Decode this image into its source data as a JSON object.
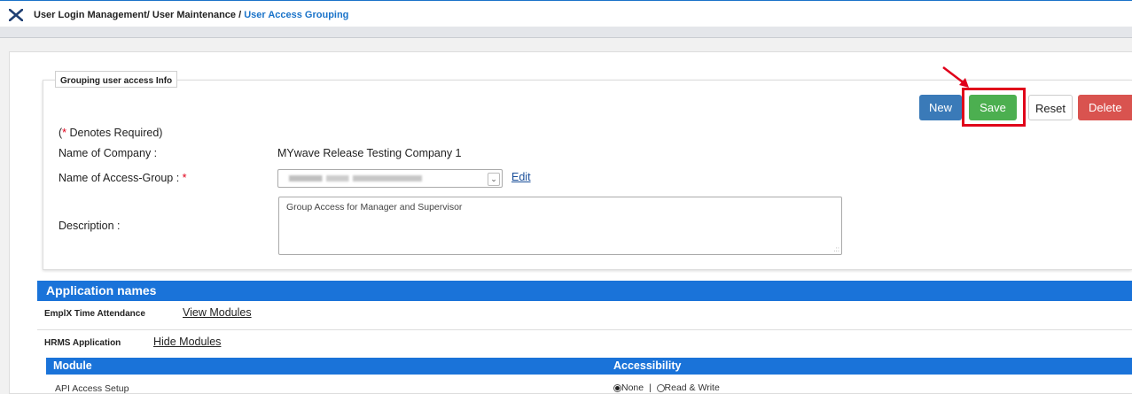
{
  "breadcrumb": {
    "part1": "User Login Management",
    "sep1": "/",
    "part2": "User Maintenance",
    "sep2": "/",
    "current": "User Access Grouping"
  },
  "panel": {
    "legend": "Grouping user access Info"
  },
  "toolbar": {
    "new_label": "New",
    "save_label": "Save",
    "reset_label": "Reset",
    "delete_label": "Delete"
  },
  "form": {
    "required_note_open": "(",
    "required_star": "*",
    "required_note_text": " Denotes Required)",
    "company_label": "Name of Company :",
    "company_value": "MYwave Release Testing Company 1",
    "group_label": "Name of Access-Group :",
    "group_star": "*",
    "edit_label": "Edit",
    "description_label": "Description :",
    "description_value": "Group Access for Manager and Supervisor"
  },
  "applications": {
    "header": "Application names",
    "items": [
      {
        "name": "EmplX Time Attendance",
        "link": "View Modules"
      },
      {
        "name": "HRMS Application",
        "link": "Hide Modules"
      }
    ]
  },
  "module_table": {
    "col_module": "Module",
    "col_access": "Accessibility",
    "rows": [
      {
        "module": "API Access Setup",
        "opt_none": "None",
        "divider": "|",
        "opt_rw": "Read & Write",
        "selected": "None"
      }
    ]
  },
  "colors": {
    "accent": "#1a73d9",
    "save": "#4caf50",
    "new": "#3a7ab8",
    "delete": "#d9534f",
    "highlight": "#e0001a"
  }
}
